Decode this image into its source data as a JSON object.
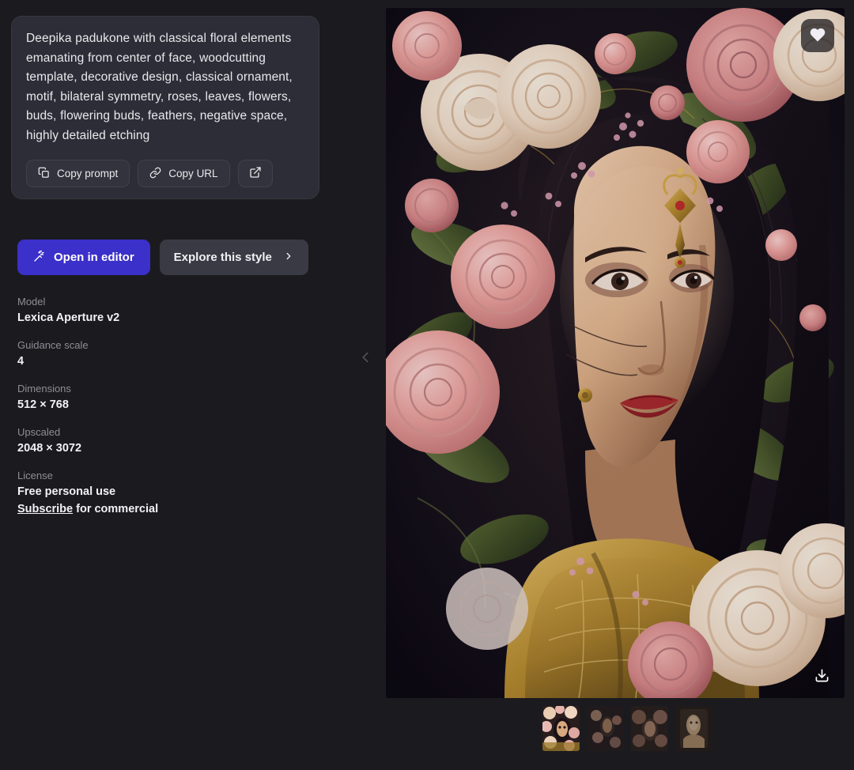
{
  "prompt": {
    "text": "Deepika padukone with classical floral elements emanating from center of face, woodcutting template, decorative design, classical ornament, motif, bilateral symmetry, roses, leaves, flowers, buds, flowering buds, feathers, negative space, highly detailed etching"
  },
  "actions": {
    "copy_prompt_label": "Copy prompt",
    "copy_prompt_icon": "copy-icon",
    "copy_url_label": "Copy URL",
    "copy_url_icon": "link-icon",
    "share_icon": "external-link-icon",
    "open_in_editor_label": "Open in editor",
    "open_in_editor_icon": "magic-wand-icon",
    "explore_style_label": "Explore this style",
    "explore_style_icon": "chevron-right-icon"
  },
  "metadata": [
    {
      "label": "Model",
      "value": "Lexica Aperture v2"
    },
    {
      "label": "Guidance scale",
      "value": "4"
    },
    {
      "label": "Dimensions",
      "value": "512 × 768"
    },
    {
      "label": "Upscaled",
      "value": "2048 × 3072"
    }
  ],
  "license": {
    "label": "License",
    "value": "Free personal use",
    "link_text": "Subscribe",
    "link_suffix": " for commercial"
  },
  "image_viewer": {
    "favorite_icon": "heart-icon",
    "download_icon": "download-icon",
    "prev_icon": "chevron-left-icon",
    "alt": "Portrait of a woman with classical floral ornament, pink and cream roses, gold jewelry"
  },
  "thumbnails": [
    {
      "name": "thumbnail-1",
      "active": true
    },
    {
      "name": "thumbnail-2",
      "active": false
    },
    {
      "name": "thumbnail-3",
      "active": false
    },
    {
      "name": "thumbnail-4",
      "active": false
    }
  ],
  "colors": {
    "page_background": "#1b1b1f",
    "card_background": "#2d2d37",
    "accent_primary": "#3b30c9",
    "secondary_button": "#3a3a44",
    "text_primary": "#f2f2f5",
    "text_muted": "#8d8d96"
  }
}
